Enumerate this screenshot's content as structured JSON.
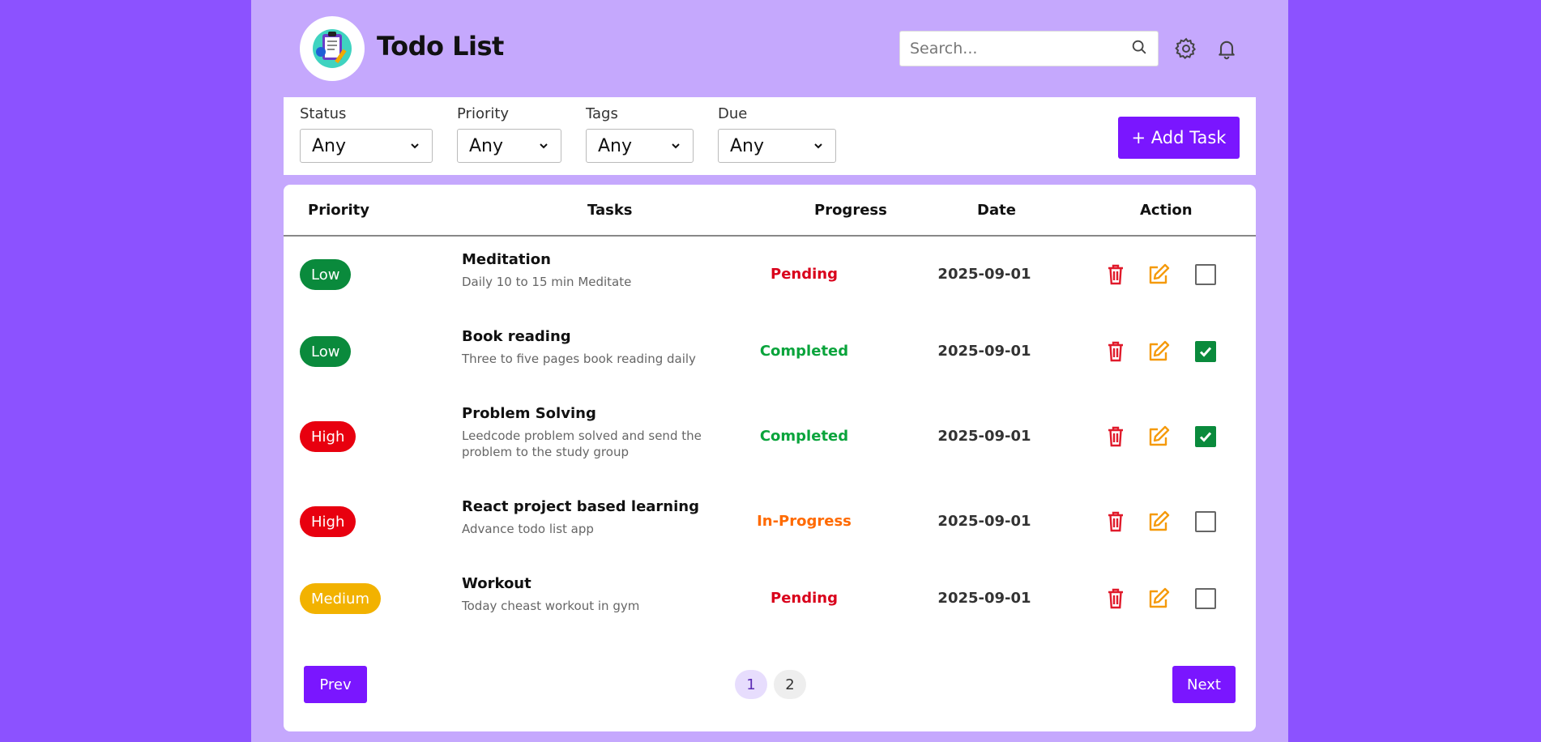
{
  "header": {
    "title": "Todo List",
    "logo_icon": "clipboard-logo-icon",
    "search_placeholder": "Search...",
    "icons": [
      "search-icon",
      "gear-icon",
      "bell-icon"
    ]
  },
  "filters": {
    "status": {
      "label": "Status",
      "value": "Any"
    },
    "priority": {
      "label": "Priority",
      "value": "Any"
    },
    "tags": {
      "label": "Tags",
      "value": "Any"
    },
    "due": {
      "label": "Due",
      "value": "Any"
    },
    "add_button": "+ Add Task"
  },
  "table": {
    "headers": {
      "priority": "Priority",
      "tasks": "Tasks",
      "progress": "Progress",
      "date": "Date",
      "action": "Action"
    },
    "rows": [
      {
        "priority": "Low",
        "title": "Meditation",
        "desc": "Daily 10 to 15 min Meditate",
        "progress": "Pending",
        "date": "2025-09-01",
        "checked": false
      },
      {
        "priority": "Low",
        "title": "Book reading",
        "desc": "Three to five pages book reading daily",
        "progress": "Completed",
        "date": "2025-09-01",
        "checked": true
      },
      {
        "priority": "High",
        "title": "Problem Solving",
        "desc": "Leedcode problem solved and send the problem to the study group",
        "progress": "Completed",
        "date": "2025-09-01",
        "checked": true
      },
      {
        "priority": "High",
        "title": "React project based learning",
        "desc": "Advance todo list app",
        "progress": "In-Progress",
        "date": "2025-09-01",
        "checked": false
      },
      {
        "priority": "Medium",
        "title": "Workout",
        "desc": "Today cheast workout in gym",
        "progress": "Pending",
        "date": "2025-09-01",
        "checked": false
      }
    ]
  },
  "pagination": {
    "prev": "Prev",
    "next": "Next",
    "pages": [
      "1",
      "2"
    ],
    "current": "1"
  },
  "colors": {
    "background": "#8c52ff",
    "panel": "#c5a8fd",
    "accent": "#7a16ff",
    "low": "#0a8a3c",
    "high": "#e8000f",
    "medium": "#f2b200",
    "pending": "#d9001b",
    "completed": "#0aa43c",
    "in_progress": "#ff6a00",
    "delete": "#e01a2b",
    "edit": "#f59a0b"
  }
}
